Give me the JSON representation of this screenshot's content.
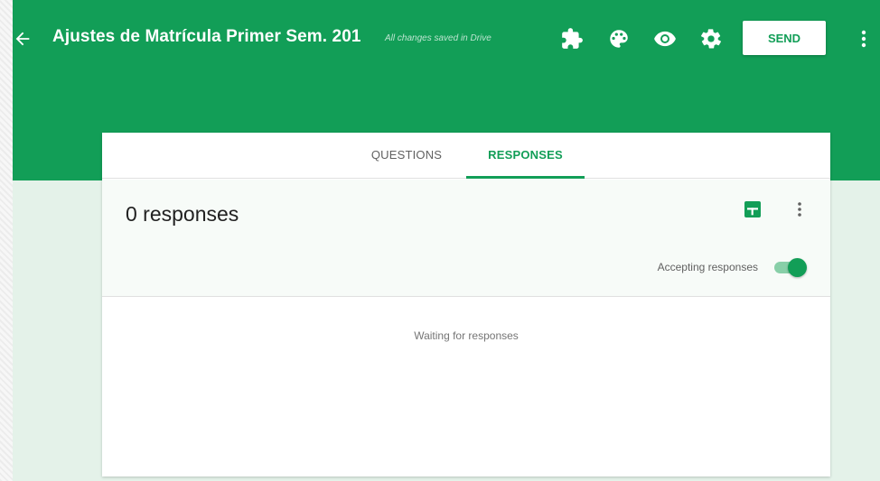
{
  "colors": {
    "brand": "#129e57",
    "brand_light": "#88cfa8",
    "background": "#e4f2e9"
  },
  "header": {
    "title": "Ajustes de Matrícula Primer Sem. 201",
    "save_status": "All changes saved in Drive",
    "send_label": "SEND",
    "icons": [
      "back-arrow-icon",
      "addon-puzzle-icon",
      "palette-icon",
      "preview-eye-icon",
      "settings-gear-icon",
      "more-vert-icon"
    ]
  },
  "tabs": [
    {
      "label": "QUESTIONS",
      "active": false
    },
    {
      "label": "RESPONSES",
      "active": true
    }
  ],
  "responses": {
    "count_label": "0 responses",
    "accepting_label": "Accepting responses",
    "accepting": true,
    "empty_message": "Waiting for responses",
    "icons": [
      "sheets-icon",
      "more-vert-icon"
    ]
  }
}
